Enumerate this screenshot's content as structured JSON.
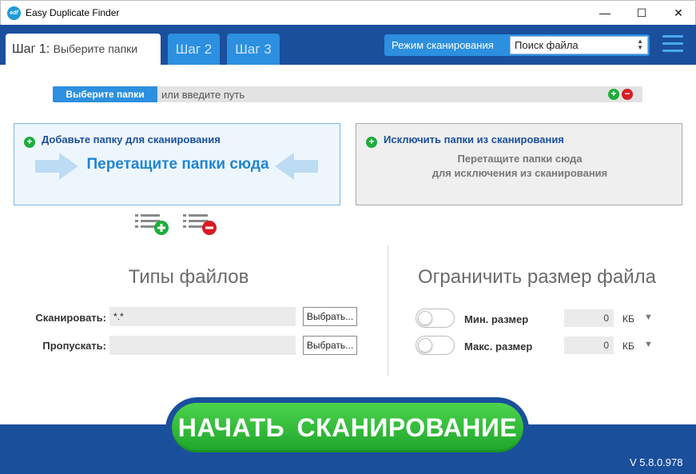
{
  "window": {
    "title": "Easy Duplicate Finder",
    "logo_text": "edf",
    "minimize_glyph": "—",
    "maximize_glyph": "☐",
    "close_glyph": "✕"
  },
  "tabs": [
    {
      "label": "Шаг 1:",
      "sublabel": "Выберите папки",
      "active": true
    },
    {
      "label": "Шаг 2",
      "active": false
    },
    {
      "label": "Шаг 3",
      "active": false
    }
  ],
  "scan_mode": {
    "label": "Режим сканирования",
    "selected": "Поиск файла"
  },
  "path_bar": {
    "button_label": "Выберите папки",
    "hint": "или введите путь",
    "add_glyph": "+",
    "remove_glyph": "−"
  },
  "add_zone": {
    "heading": "Добавьте папку для сканирования",
    "main_text": "Перетащите папки сюда",
    "icon_glyph": "+"
  },
  "exclude_zone": {
    "heading": "Исключить папки из сканирования",
    "line1": "Перетащите папки сюда",
    "line2": "для исключения из сканирования",
    "icon_glyph": "+"
  },
  "file_types": {
    "title": "Типы файлов",
    "scan_label": "Сканировать:",
    "scan_value": "*.*",
    "skip_label": "Пропускать:",
    "skip_value": "",
    "choose_button": "Выбрать..."
  },
  "size_limit": {
    "title": "Ограничить размер файла",
    "min_label": "Мин. размер",
    "min_value": "0",
    "max_label": "Макс. размер",
    "max_value": "0",
    "unit": "КБ",
    "dropdown_glyph": "▼",
    "min_enabled": false,
    "max_enabled": false
  },
  "start_button": {
    "label": "НАЧАТЬ СКАНИРОВАНИЕ"
  },
  "version": "V 5.8.0.978",
  "colors": {
    "header_blue": "#1a4f9c",
    "tab_blue": "#2c8fe0",
    "accent_green": "#1cae3b",
    "accent_red": "#d71c24",
    "start_green": "#2fbf35"
  }
}
